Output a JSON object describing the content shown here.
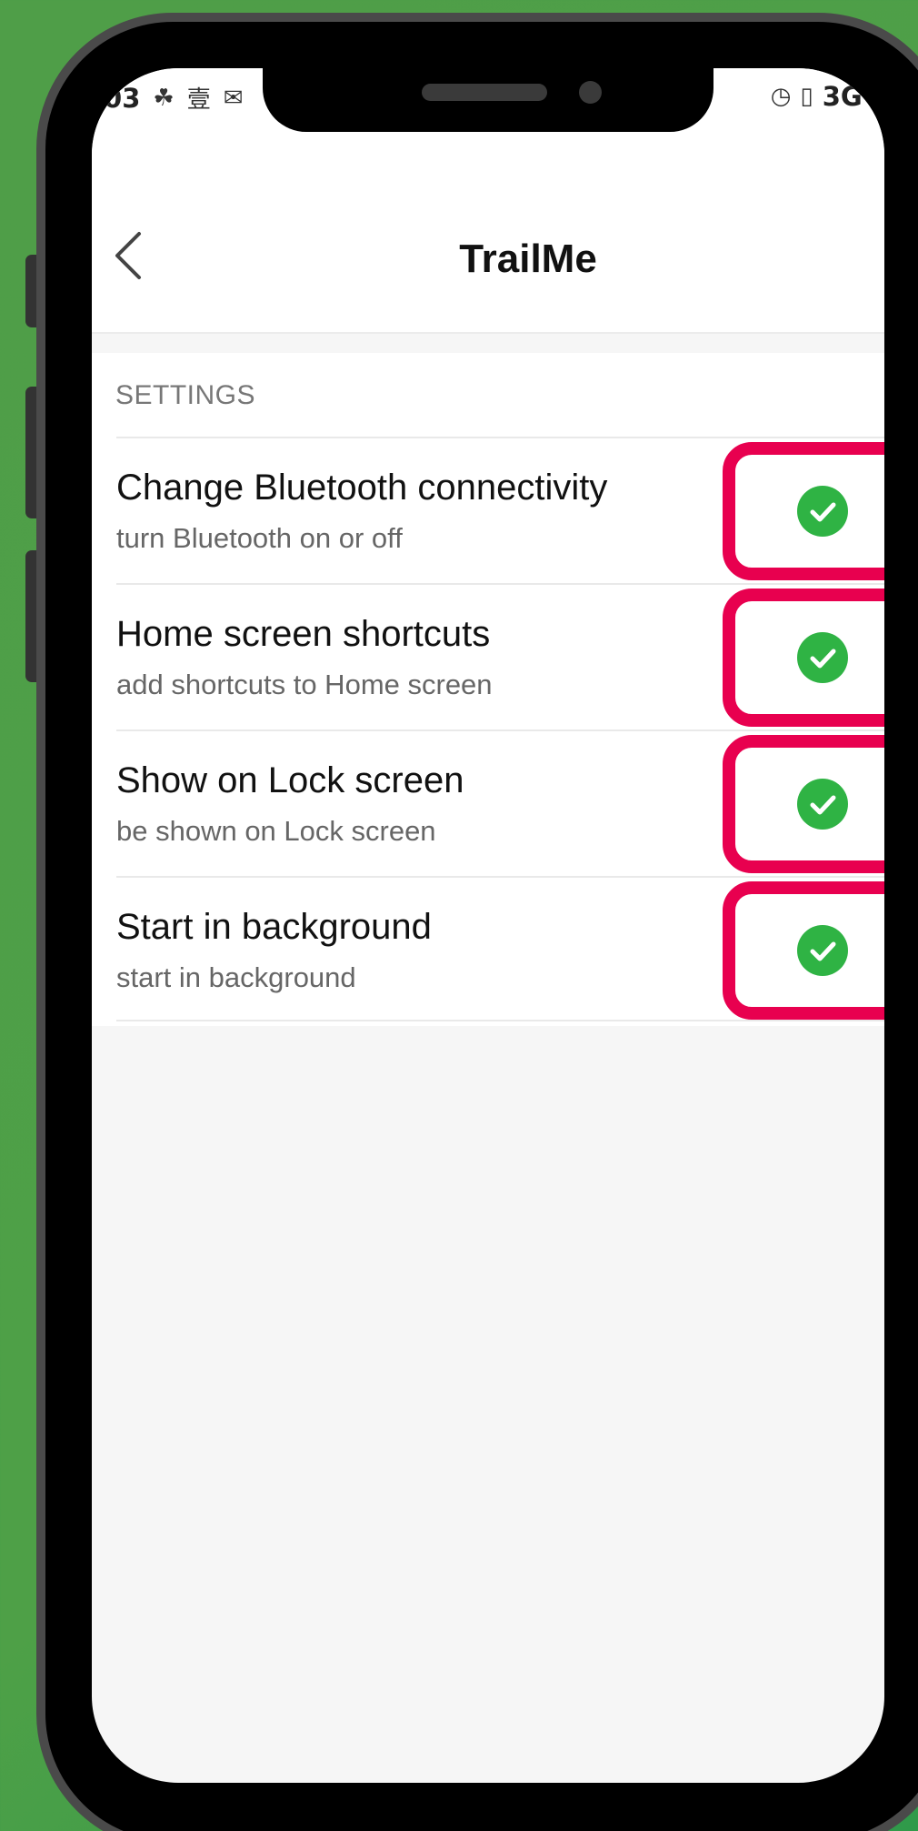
{
  "status_bar": {
    "time": ".03",
    "left_icons": [
      "news-now-icon",
      "app-notification-icon",
      "mail-icon"
    ],
    "right_text": "3G",
    "right_icons": [
      "alarm-icon",
      "signal-icon",
      "signal-icon"
    ]
  },
  "header": {
    "title": "TrailMe",
    "back_icon": "chevron-left-icon"
  },
  "settings": {
    "section_label": "SETTINGS",
    "items": [
      {
        "title": "Change Bluetooth connectivity",
        "subtitle": "turn Bluetooth on or off",
        "enabled": true
      },
      {
        "title": "Home screen shortcuts",
        "subtitle": "add shortcuts to Home screen",
        "enabled": true
      },
      {
        "title": "Show on Lock screen",
        "subtitle": "be shown on Lock screen",
        "enabled": true
      },
      {
        "title": "Start in background",
        "subtitle": "start in background",
        "enabled": true
      }
    ]
  },
  "colors": {
    "background_green": "#4f9e48",
    "highlight": "#e8004f",
    "check": "#2fb344"
  }
}
